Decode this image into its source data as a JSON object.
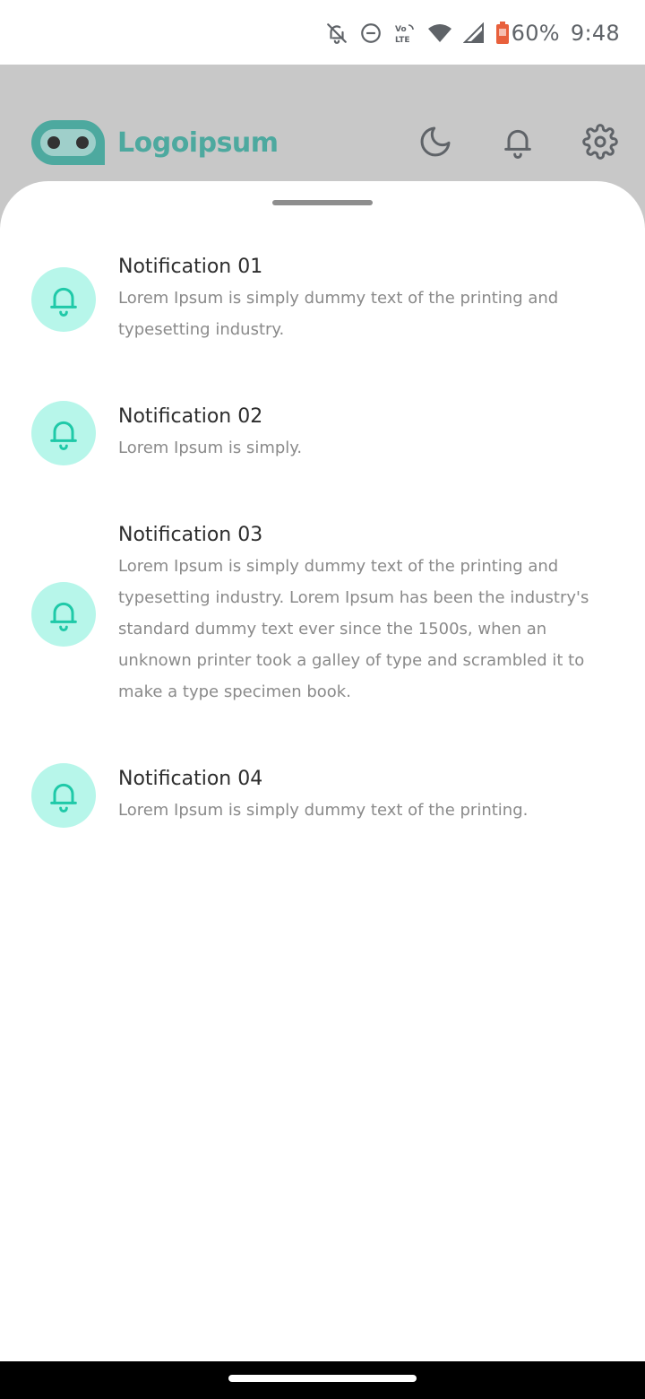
{
  "status_bar": {
    "battery": "60%",
    "time": "9:48",
    "icons": [
      "notifications-off-icon",
      "do-not-disturb-icon",
      "volte-icon",
      "wifi-icon",
      "signal-icon",
      "battery-icon"
    ],
    "battery_color": "#e8603c"
  },
  "header": {
    "logo_text": "Logoipsum",
    "brand_color": "#4da99f",
    "actions": [
      "dark-mode-icon",
      "bell-icon",
      "gear-icon"
    ]
  },
  "notifications": [
    {
      "title": "Notification 01",
      "text": "Lorem Ipsum is simply dummy text of the printing and typesetting industry."
    },
    {
      "title": "Notification 02",
      "text": "Lorem Ipsum is simply."
    },
    {
      "title": "Notification 03",
      "text": "Lorem Ipsum is simply dummy text of the printing and typesetting industry. Lorem Ipsum has been the industry's standard dummy text ever since the 1500s, when an unknown printer took a galley of type and scrambled it to make a type specimen book."
    },
    {
      "title": "Notification 04",
      "text": "Lorem Ipsum is simply dummy text of the printing."
    }
  ],
  "colors": {
    "accent": "#1fc9a8",
    "icon_bg": "#b7f6ea"
  }
}
